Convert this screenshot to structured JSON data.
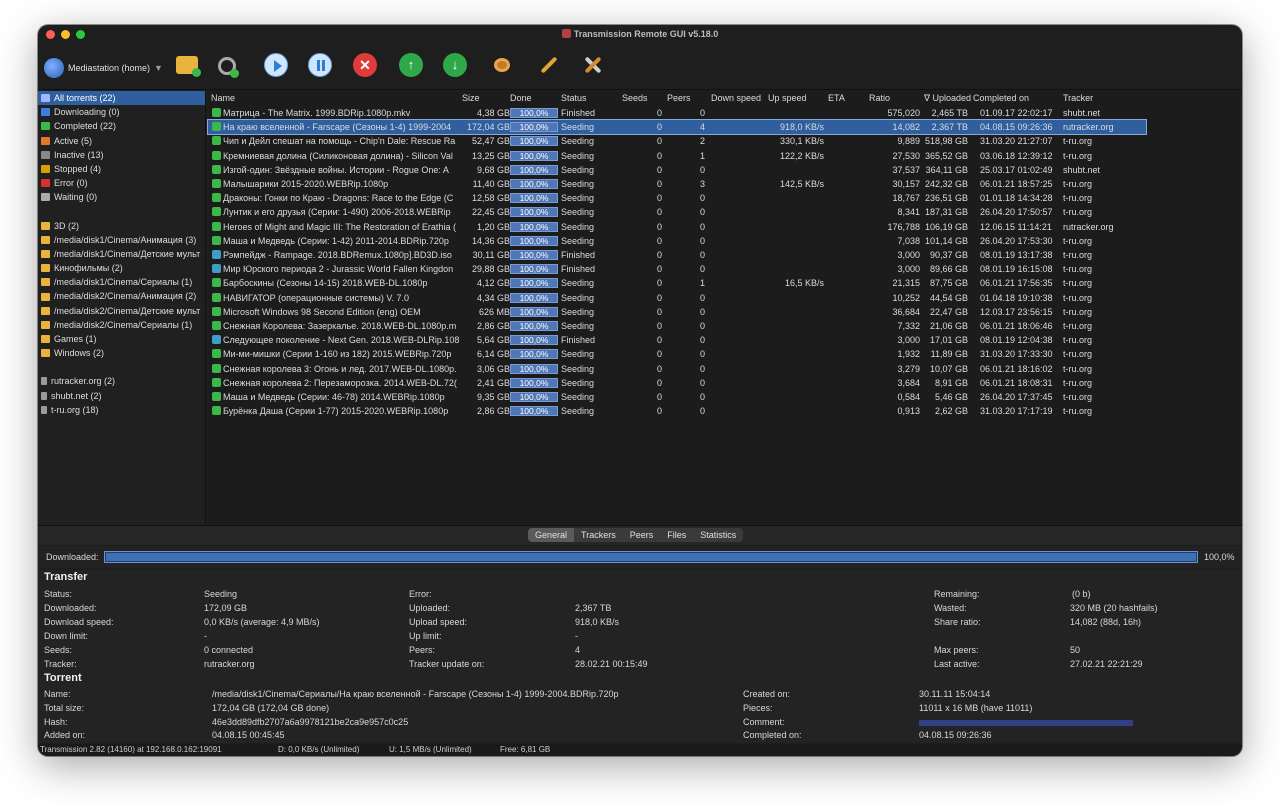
{
  "window": {
    "title": "Transmission Remote GUI v5.18.0"
  },
  "toolbar": {
    "host": "Mediastation (home)"
  },
  "sidebar": {
    "filters": [
      {
        "label": "All torrents (22)",
        "color": "#9fb7ff",
        "selected": true
      },
      {
        "label": "Downloading (0)",
        "color": "#3d7fe0"
      },
      {
        "label": "Completed (22)",
        "color": "#3bb84a"
      },
      {
        "label": "Active (5)",
        "color": "#e07a2a"
      },
      {
        "label": "Inactive (13)",
        "color": "#888888"
      },
      {
        "label": "Stopped (4)",
        "color": "#d9a000"
      },
      {
        "label": "Error (0)",
        "color": "#d93030"
      },
      {
        "label": "Waiting (0)",
        "color": "#aaaaaa"
      }
    ],
    "folders": [
      "3D (2)",
      "/media/disk1/Cinema/Анимация (3)",
      "/media/disk1/Cinema/Детские мульт",
      "Кинофильмы (2)",
      "/media/disk1/Cinema/Сериалы (1)",
      "/media/disk2/Cinema/Анимация (2)",
      "/media/disk2/Cinema/Детские мульт",
      "/media/disk2/Cinema/Сериалы (1)",
      "Games (1)",
      "Windows (2)"
    ],
    "trackers": [
      "rutracker.org (2)",
      "shubt.net (2)",
      "t-ru.org (18)"
    ]
  },
  "table": {
    "headers": {
      "name": "Name",
      "size": "Size",
      "done": "Done",
      "status": "Status",
      "seeds": "Seeds",
      "peers": "Peers",
      "down": "Down speed",
      "up": "Up speed",
      "eta": "ETA",
      "ratio": "Ratio",
      "uploaded": "∇ Uploaded",
      "completed": "Completed on",
      "tracker": "Tracker"
    },
    "rows": [
      {
        "name": "Матрица - The Matrix. 1999.BDRip.1080p.mkv",
        "size": "4,38 GB",
        "done": "100,0%",
        "status": "Finished",
        "seeds": "0",
        "peers": "0",
        "down": "",
        "up": "",
        "ratio": "575,020",
        "uploaded": "2,465 TB",
        "completed": "01.09.17 22:02:17",
        "tracker": "shubt.net",
        "icon": "#3bb84a"
      },
      {
        "name": "На краю вселенной - Farscape (Сезоны 1-4) 1999-2004",
        "size": "172,04 GB",
        "done": "100,0%",
        "status": "Seeding",
        "seeds": "0",
        "peers": "4",
        "down": "",
        "up": "918,0 KB/s",
        "ratio": "14,082",
        "uploaded": "2,367 TB",
        "completed": "04.08.15 09:26:36",
        "tracker": "rutracker.org",
        "icon": "#3bb84a",
        "selected": true
      },
      {
        "name": "Чип и Дейл спешат на помощь - Chip'n Dale: Rescue Ra",
        "size": "52,47 GB",
        "done": "100,0%",
        "status": "Seeding",
        "seeds": "0",
        "peers": "2",
        "down": "",
        "up": "330,1 KB/s",
        "ratio": "9,889",
        "uploaded": "518,98 GB",
        "completed": "31.03.20 21:27:07",
        "tracker": "t-ru.org",
        "icon": "#3bb84a"
      },
      {
        "name": "Кремниевая долина (Силиконовая долина) - Silicon Val",
        "size": "13,25 GB",
        "done": "100,0%",
        "status": "Seeding",
        "seeds": "0",
        "peers": "1",
        "down": "",
        "up": "122,2 KB/s",
        "ratio": "27,530",
        "uploaded": "365,52 GB",
        "completed": "03.06.18 12:39:12",
        "tracker": "t-ru.org",
        "icon": "#3bb84a"
      },
      {
        "name": "Изгой-один: Звёздные войны. Истории - Rogue One: A",
        "size": "9,68 GB",
        "done": "100,0%",
        "status": "Seeding",
        "seeds": "0",
        "peers": "0",
        "down": "",
        "up": "",
        "ratio": "37,537",
        "uploaded": "364,11 GB",
        "completed": "25.03.17 01:02:49",
        "tracker": "shubt.net",
        "icon": "#3bb84a"
      },
      {
        "name": "Малышарики 2015-2020.WEBRip.1080p",
        "size": "11,40 GB",
        "done": "100,0%",
        "status": "Seeding",
        "seeds": "0",
        "peers": "3",
        "down": "",
        "up": "142,5 KB/s",
        "ratio": "30,157",
        "uploaded": "242,32 GB",
        "completed": "06.01.21 18:57:25",
        "tracker": "t-ru.org",
        "icon": "#3bb84a"
      },
      {
        "name": "Драконы: Гонки по Краю - Dragons: Race to the Edge (С",
        "size": "12,58 GB",
        "done": "100,0%",
        "status": "Seeding",
        "seeds": "0",
        "peers": "0",
        "down": "",
        "up": "",
        "ratio": "18,767",
        "uploaded": "236,51 GB",
        "completed": "01.01.18 14:34:28",
        "tracker": "t-ru.org",
        "icon": "#3bb84a"
      },
      {
        "name": "Лунтик и его друзья (Серии: 1-490) 2006-2018.WEBRip",
        "size": "22,45 GB",
        "done": "100,0%",
        "status": "Seeding",
        "seeds": "0",
        "peers": "0",
        "down": "",
        "up": "",
        "ratio": "8,341",
        "uploaded": "187,31 GB",
        "completed": "26.04.20 17:50:57",
        "tracker": "t-ru.org",
        "icon": "#3bb84a"
      },
      {
        "name": "Heroes of Might and Magic III: The Restoration of Erathia (",
        "size": "1,20 GB",
        "done": "100,0%",
        "status": "Seeding",
        "seeds": "0",
        "peers": "0",
        "down": "",
        "up": "",
        "ratio": "176,788",
        "uploaded": "106,19 GB",
        "completed": "12.06.15 11:14:21",
        "tracker": "rutracker.org",
        "icon": "#3bb84a"
      },
      {
        "name": "Маша и Медведь (Серии: 1-42) 2011-2014.BDRip.720p",
        "size": "14,36 GB",
        "done": "100,0%",
        "status": "Seeding",
        "seeds": "0",
        "peers": "0",
        "down": "",
        "up": "",
        "ratio": "7,038",
        "uploaded": "101,14 GB",
        "completed": "26.04.20 17:53:30",
        "tracker": "t-ru.org",
        "icon": "#3bb84a"
      },
      {
        "name": "Рэмпейдж - Rampage. 2018.BDRemux.1080p].BD3D.iso",
        "size": "30,11 GB",
        "done": "100,0%",
        "status": "Finished",
        "seeds": "0",
        "peers": "0",
        "down": "",
        "up": "",
        "ratio": "3,000",
        "uploaded": "90,37 GB",
        "completed": "08.01.19 13:17:38",
        "tracker": "t-ru.org",
        "icon": "#3b9ec8"
      },
      {
        "name": "Мир Юрского периода 2 - Jurassic World Fallen Kingdon",
        "size": "29,88 GB",
        "done": "100,0%",
        "status": "Finished",
        "seeds": "0",
        "peers": "0",
        "down": "",
        "up": "",
        "ratio": "3,000",
        "uploaded": "89,66 GB",
        "completed": "08.01.19 16:15:08",
        "tracker": "t-ru.org",
        "icon": "#3b9ec8"
      },
      {
        "name": "Барбоскины (Сезоны 14-15) 2018.WEB-DL.1080p",
        "size": "4,12 GB",
        "done": "100,0%",
        "status": "Seeding",
        "seeds": "0",
        "peers": "1",
        "down": "",
        "up": "16,5 KB/s",
        "ratio": "21,315",
        "uploaded": "87,75 GB",
        "completed": "06.01.21 17:56:35",
        "tracker": "t-ru.org",
        "icon": "#3bb84a"
      },
      {
        "name": "НАВИГАТОР (операционные системы) V. 7.0",
        "size": "4,34 GB",
        "done": "100,0%",
        "status": "Seeding",
        "seeds": "0",
        "peers": "0",
        "down": "",
        "up": "",
        "ratio": "10,252",
        "uploaded": "44,54 GB",
        "completed": "01.04.18 19:10:38",
        "tracker": "t-ru.org",
        "icon": "#3bb84a"
      },
      {
        "name": "Microsoft Windows 98 Second Edition (eng) OEM",
        "size": "626 MB",
        "done": "100,0%",
        "status": "Seeding",
        "seeds": "0",
        "peers": "0",
        "down": "",
        "up": "",
        "ratio": "36,684",
        "uploaded": "22,47 GB",
        "completed": "12.03.17 23:56:15",
        "tracker": "t-ru.org",
        "icon": "#3bb84a"
      },
      {
        "name": "Снежная Королева: Зазеркалье. 2018.WEB-DL.1080p.m",
        "size": "2,86 GB",
        "done": "100,0%",
        "status": "Seeding",
        "seeds": "0",
        "peers": "0",
        "down": "",
        "up": "",
        "ratio": "7,332",
        "uploaded": "21,06 GB",
        "completed": "06.01.21 18:06:46",
        "tracker": "t-ru.org",
        "icon": "#3bb84a"
      },
      {
        "name": "Следующее поколение - Next Gen. 2018.WEB-DLRip.108",
        "size": "5,64 GB",
        "done": "100,0%",
        "status": "Finished",
        "seeds": "0",
        "peers": "0",
        "down": "",
        "up": "",
        "ratio": "3,000",
        "uploaded": "17,01 GB",
        "completed": "08.01.19 12:04:38",
        "tracker": "t-ru.org",
        "icon": "#3b9ec8"
      },
      {
        "name": "Ми-ми-мишки (Серии 1-160 из 182) 2015.WEBRip.720p",
        "size": "6,14 GB",
        "done": "100,0%",
        "status": "Seeding",
        "seeds": "0",
        "peers": "0",
        "down": "",
        "up": "",
        "ratio": "1,932",
        "uploaded": "11,89 GB",
        "completed": "31.03.20 17:33:30",
        "tracker": "t-ru.org",
        "icon": "#3bb84a"
      },
      {
        "name": "Снежная королева 3: Огонь и лед. 2017.WEB-DL.1080p.",
        "size": "3,06 GB",
        "done": "100,0%",
        "status": "Seeding",
        "seeds": "0",
        "peers": "0",
        "down": "",
        "up": "",
        "ratio": "3,279",
        "uploaded": "10,07 GB",
        "completed": "06.01.21 18:16:02",
        "tracker": "t-ru.org",
        "icon": "#3bb84a"
      },
      {
        "name": "Снежная королева 2: Перезаморозка. 2014.WEB-DL.72(",
        "size": "2,41 GB",
        "done": "100,0%",
        "status": "Seeding",
        "seeds": "0",
        "peers": "0",
        "down": "",
        "up": "",
        "ratio": "3,684",
        "uploaded": "8,91 GB",
        "completed": "06.01.21 18:08:31",
        "tracker": "t-ru.org",
        "icon": "#3bb84a"
      },
      {
        "name": "Маша и Медведь (Серии: 46-78) 2014.WEBRip.1080p",
        "size": "9,35 GB",
        "done": "100,0%",
        "status": "Seeding",
        "seeds": "0",
        "peers": "0",
        "down": "",
        "up": "",
        "ratio": "0,584",
        "uploaded": "5,46 GB",
        "completed": "26.04.20 17:37:45",
        "tracker": "t-ru.org",
        "icon": "#3bb84a"
      },
      {
        "name": "Бурёнка Даша (Серии 1-77) 2015-2020.WEBRip.1080p",
        "size": "2,86 GB",
        "done": "100,0%",
        "status": "Seeding",
        "seeds": "0",
        "peers": "0",
        "down": "",
        "up": "",
        "ratio": "0,913",
        "uploaded": "2,62 GB",
        "completed": "31.03.20 17:17:19",
        "tracker": "t-ru.org",
        "icon": "#3bb84a"
      }
    ]
  },
  "tabs": [
    "General",
    "Trackers",
    "Peers",
    "Files",
    "Statistics"
  ],
  "downloaded": {
    "label": "Downloaded:",
    "value": "100,0%",
    "progress": 1.0
  },
  "transfer": {
    "title": "Transfer",
    "status_l": "Status:",
    "status_v": "Seeding",
    "error_l": "Error:",
    "error_v": "",
    "remaining_l": "Remaining:",
    "remaining_v": "(0 b)",
    "downloaded_l": "Downloaded:",
    "downloaded_v": "172,09 GB",
    "uploaded_l": "Uploaded:",
    "uploaded_v": "2,367 TB",
    "wasted_l": "Wasted:",
    "wasted_v": "320 MB (20 hashfails)",
    "dspeed_l": "Download speed:",
    "dspeed_v": "0,0 KB/s (average: 4,9 MB/s)",
    "uspeed_l": "Upload speed:",
    "uspeed_v": "918,0 KB/s",
    "ratio_l": "Share ratio:",
    "ratio_v": "14,082 (88d, 16h)",
    "dlimit_l": "Down limit:",
    "dlimit_v": "-",
    "ulimit_l": "Up limit:",
    "ulimit_v": "-",
    "seeds_l": "Seeds:",
    "seeds_v": "0 connected",
    "peers_l": "Peers:",
    "peers_v": "4",
    "maxpeers_l": "Max peers:",
    "maxpeers_v": "50",
    "tracker_l": "Tracker:",
    "tracker_v": "rutracker.org",
    "tupdate_l": "Tracker update on:",
    "tupdate_v": "28.02.21 00:15:49",
    "lastactive_l": "Last active:",
    "lastactive_v": "27.02.21 22:21:29"
  },
  "torrent": {
    "title": "Torrent",
    "name_l": "Name:",
    "name_v": "/media/disk1/Cinema/Сериалы/На краю вселенной - Farscape (Сезоны 1-4) 1999-2004.BDRip.720p",
    "created_l": "Created on:",
    "created_v": "30.11.11 15:04:14",
    "total_l": "Total size:",
    "total_v": "172,04 GB (172,04 GB done)",
    "pieces_l": "Pieces:",
    "pieces_v": "11011 x 16 MB (have 11011)",
    "hash_l": "Hash:",
    "hash_v": "46e3dd89dfb2707a6a9978121be2ca9e957c0c25",
    "comment_l": "Comment:",
    "added_l": "Added on:",
    "added_v": "04.08.15 00:45:45",
    "completed_l": "Completed on:",
    "completed_v": "04.08.15 09:26:36"
  },
  "statusbar": {
    "conn": "Transmission 2.82 (14160) at 192.168.0.162:19091",
    "down": "D: 0,0 KB/s (Unlimited)",
    "up": "U: 1,5 MB/s (Unlimited)",
    "free": "Free: 6,81 GB"
  }
}
